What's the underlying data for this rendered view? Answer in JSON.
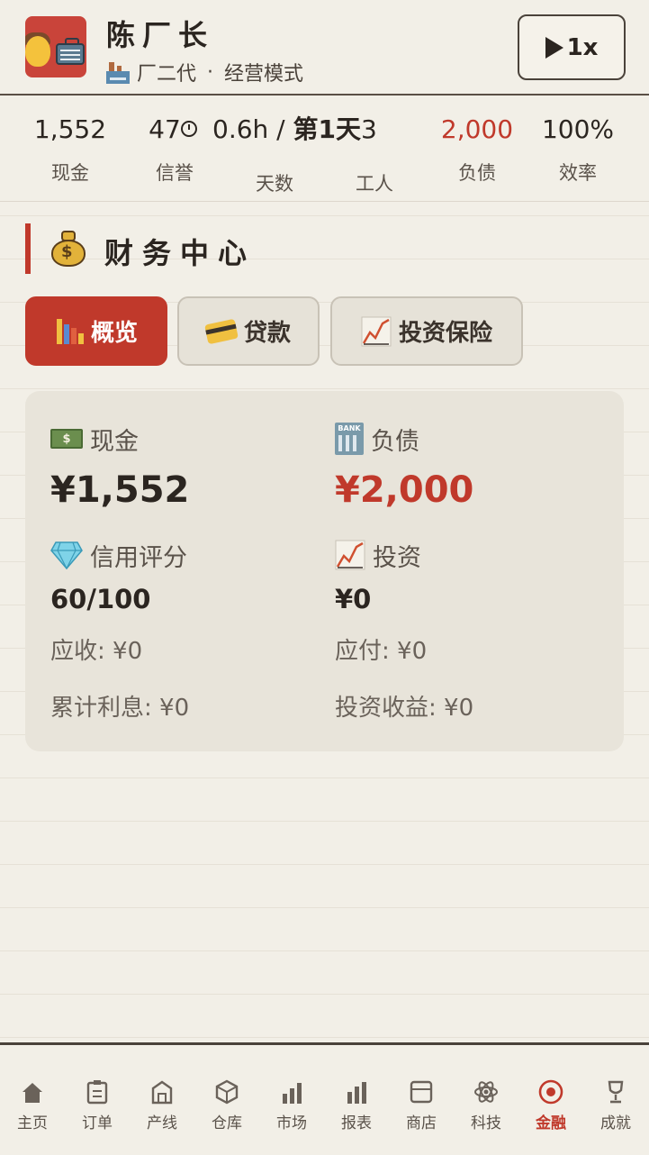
{
  "header": {
    "player_name": "陈厂长",
    "subtitle_role": "厂二代",
    "subtitle_sep": "·",
    "subtitle_mode": "经营模式",
    "speed_label": "1x"
  },
  "stats": [
    {
      "value": "1,552",
      "label": "现金"
    },
    {
      "value": "47",
      "label": "信誉"
    },
    {
      "value": "0.6h / ",
      "value_bold": "第1天",
      "value_tail": "3",
      "label": "天数"
    },
    {
      "value": "",
      "label": "工人"
    },
    {
      "value": "2,000",
      "label": "负债",
      "color": "#c0392b"
    },
    {
      "value": "100%",
      "label": "效率"
    }
  ],
  "section": {
    "title": "财务中心",
    "icon": "money-bag-icon"
  },
  "tabs": [
    {
      "label": "概览",
      "icon": "bar-chart-icon",
      "active": true
    },
    {
      "label": "贷款",
      "icon": "credit-card-icon",
      "active": false
    },
    {
      "label": "投资保险",
      "icon": "trend-chart-icon",
      "active": false
    }
  ],
  "overview": {
    "cash": {
      "label": "现金",
      "value": "¥1,552",
      "icon": "banknote-icon"
    },
    "debt": {
      "label": "负债",
      "value": "¥2,000",
      "icon": "bank-icon"
    },
    "credit": {
      "label": "信用评分",
      "value": "60/100",
      "icon": "gem-icon"
    },
    "investment": {
      "label": "投资",
      "value": "¥0",
      "icon": "trend-chart-icon"
    },
    "receivable": "应收: ¥0",
    "payable": "应付: ¥0",
    "interest": "累计利息: ¥0",
    "investment_return": "投资收益: ¥0"
  },
  "accent_color": "#c0392b",
  "bottom_nav": [
    {
      "label": "主页",
      "icon": "home-icon"
    },
    {
      "label": "订单",
      "icon": "clipboard-icon"
    },
    {
      "label": "产线",
      "icon": "factory-icon"
    },
    {
      "label": "仓库",
      "icon": "box-icon"
    },
    {
      "label": "市场",
      "icon": "bar-chart-icon"
    },
    {
      "label": "报表",
      "icon": "report-icon"
    },
    {
      "label": "商店",
      "icon": "shop-icon"
    },
    {
      "label": "科技",
      "icon": "atom-icon"
    },
    {
      "label": "金融",
      "icon": "target-icon",
      "active": true
    },
    {
      "label": "成就",
      "icon": "trophy-icon"
    }
  ]
}
